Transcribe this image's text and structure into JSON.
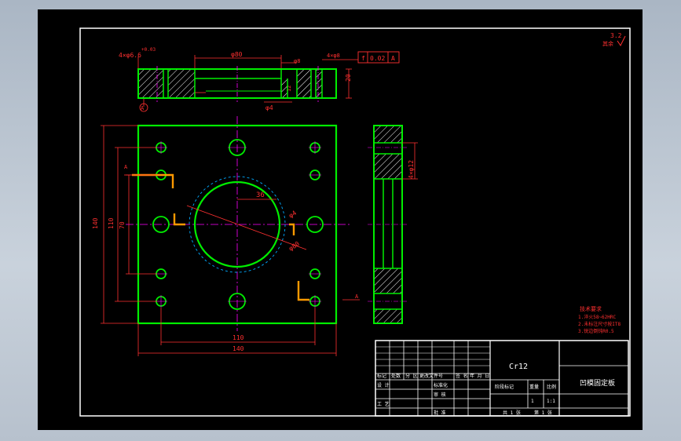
{
  "drawing": {
    "roughness": "3.2",
    "roughness_note": "其余",
    "dims": {
      "top_holes": "4×φ6.6",
      "top_holes_tol": "+0.03",
      "top_dia80": "φ80",
      "top_dia8": "φ8",
      "top_holes2": "4×φ8",
      "flatness_sym": "f",
      "flatness_val": "0.02",
      "datum": "A",
      "thickness": "20",
      "small_dia": "φ4",
      "depth": "12",
      "callout_a": "A",
      "radius": "36",
      "phi_a": "φ4",
      "phi_b": "φ80",
      "side_holes": "4×φ12",
      "h140": "140",
      "h110": "110",
      "h70": "70",
      "w110": "110",
      "w140": "140",
      "section_a": "A",
      "section_a2": "A"
    }
  },
  "tech_req": {
    "title": "技术要求",
    "items": [
      "1.淬火58~62HRC",
      "2.未标注尺寸按IT8",
      "3.锐边倒钝R0.5"
    ]
  },
  "title_block": {
    "material": "Cr12",
    "part_name": "凹模固定板",
    "hdr": [
      "标记",
      "处数",
      "分 区",
      "更改文件号",
      "签 名",
      "年 月 日"
    ],
    "design": "设 计",
    "standard": "标准化",
    "review": "审 核",
    "process": "工 艺",
    "approve": "批 准",
    "stage": "阶段标记",
    "weight": "重量",
    "scale": "比例",
    "scale_val": "1:1",
    "qty": "1",
    "sheets": "共 1 张",
    "sheet_no": "第 1 张"
  }
}
